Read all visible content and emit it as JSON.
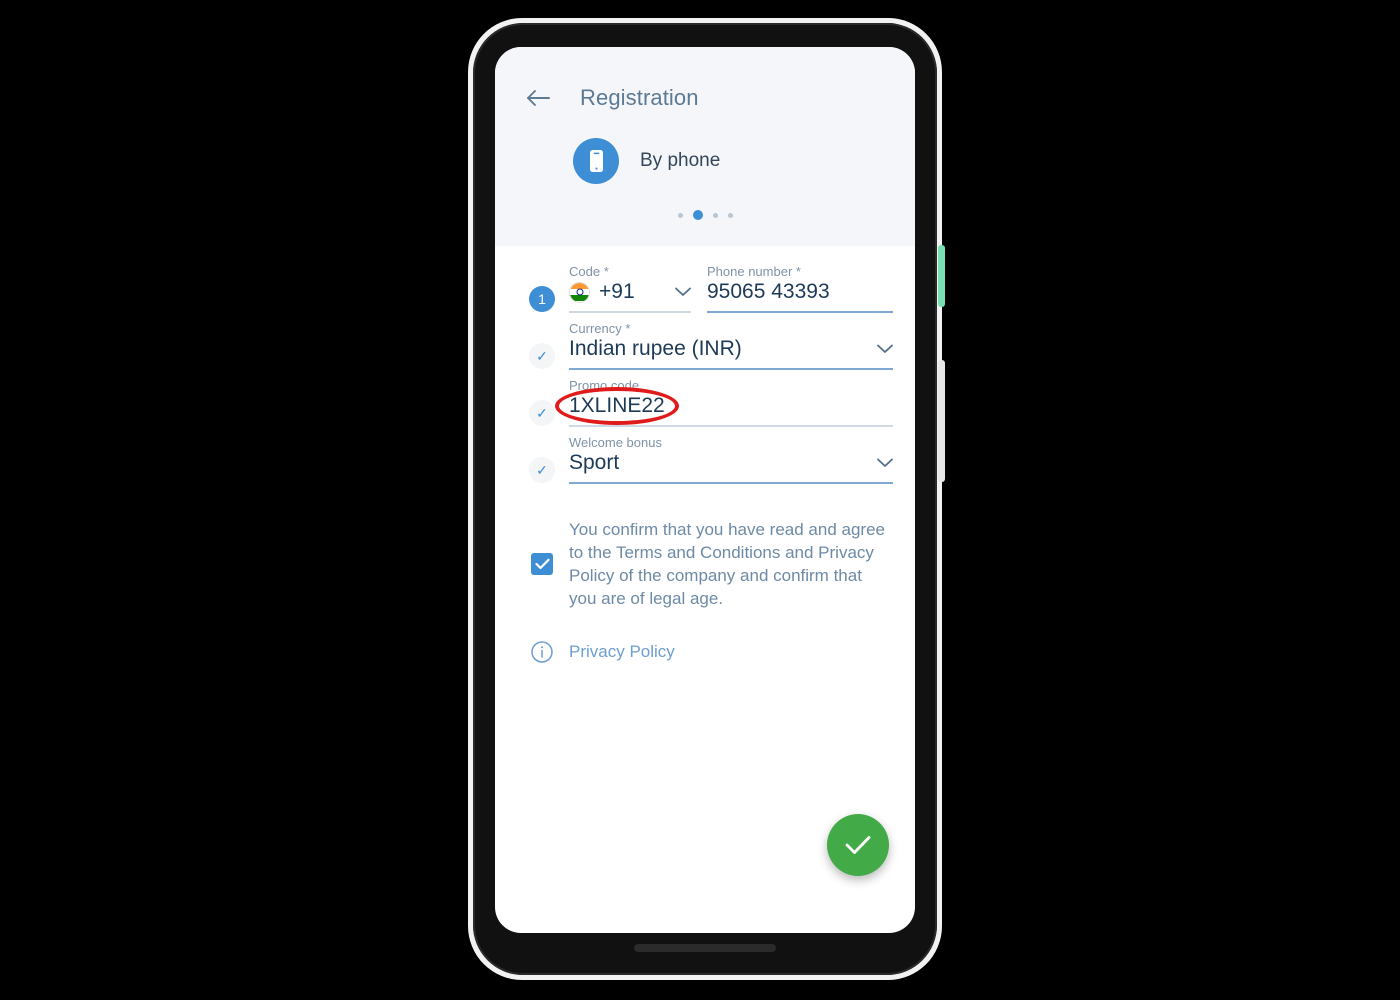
{
  "device": {
    "power_button": "power-button",
    "volume_rocker": "volume-rocker"
  },
  "header": {
    "back_icon": "arrow-left-icon",
    "title": "Registration",
    "method_icon": "smartphone-icon",
    "method_label": "By phone",
    "dots_total": 4,
    "dots_active_index": 1,
    "background_color": "#f4f6f9"
  },
  "form": {
    "steps": [
      {
        "type": "number",
        "value": "1"
      },
      {
        "type": "check",
        "value": "✓"
      },
      {
        "type": "check",
        "value": "✓"
      },
      {
        "type": "check",
        "value": "✓"
      }
    ],
    "code": {
      "label": "Code *",
      "flag_icon": "flag-india-icon",
      "value": "+91",
      "chevron": "∨"
    },
    "phone": {
      "label": "Phone number *",
      "value": "95065 43393"
    },
    "currency": {
      "label": "Currency *",
      "value": "Indian rupee (INR)",
      "chevron": "∨"
    },
    "promo": {
      "label": "Promo code",
      "value": "1XLINE22",
      "annotation_color": "#e01b1b"
    },
    "bonus": {
      "label": "Welcome bonus",
      "value": "Sport",
      "chevron": "∨"
    }
  },
  "consent": {
    "checked": true,
    "text": "You confirm that you have read and agree to the Terms and Conditions and Privacy Policy of the company and confirm that you are of legal age."
  },
  "privacy": {
    "info_icon": "info-circle-icon",
    "link_label": "Privacy Policy"
  },
  "fab": {
    "icon": "check-icon",
    "color": "#42ab48"
  },
  "colors": {
    "accent_blue": "#3d8ed4",
    "text_dark": "#1d3a57",
    "label_gray": "#7f93a8",
    "green": "#42ab48",
    "annotation_red": "#e01b1b"
  }
}
